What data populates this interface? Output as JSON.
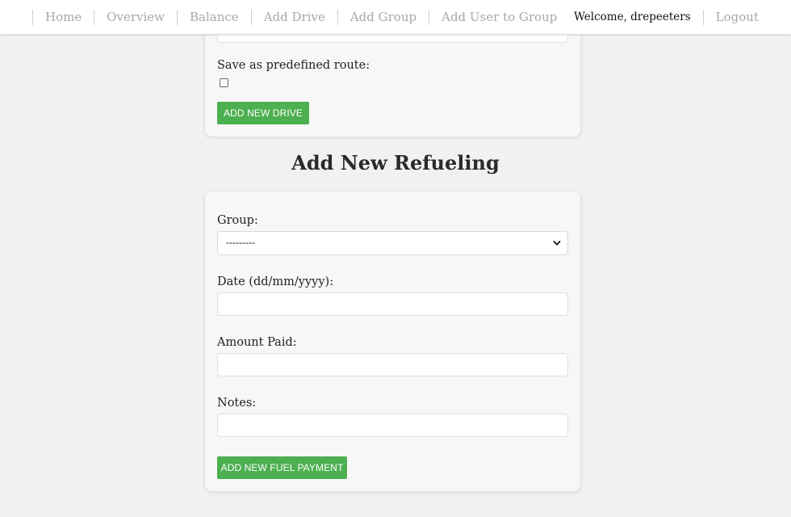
{
  "nav": {
    "links": [
      "Home",
      "Overview",
      "Balance",
      "Add Drive",
      "Add Group",
      "Add User to Group"
    ],
    "welcome": "Welcome, drepeeters",
    "logout": "Logout"
  },
  "drive_form": {
    "predefined_label": "Save as predefined route:",
    "predefined_checked": false,
    "submit_label": "ADD NEW DRIVE"
  },
  "refuel_form": {
    "title": "Add New Refueling",
    "group_label": "Group:",
    "group_value": "---------",
    "date_label": "Date (dd/mm/yyyy):",
    "date_value": "",
    "amount_label": "Amount Paid:",
    "amount_value": "",
    "notes_label": "Notes:",
    "notes_value": "",
    "submit_label": "ADD NEW FUEL PAYMENT"
  },
  "colors": {
    "accent": "#4caf50",
    "background": "#f1f1f1",
    "card": "#f7f7f7",
    "nav_link": "#a8a8a8"
  },
  "icons": {
    "select_arrow": "chevron-down-icon",
    "checkbox": "checkbox-unchecked"
  }
}
